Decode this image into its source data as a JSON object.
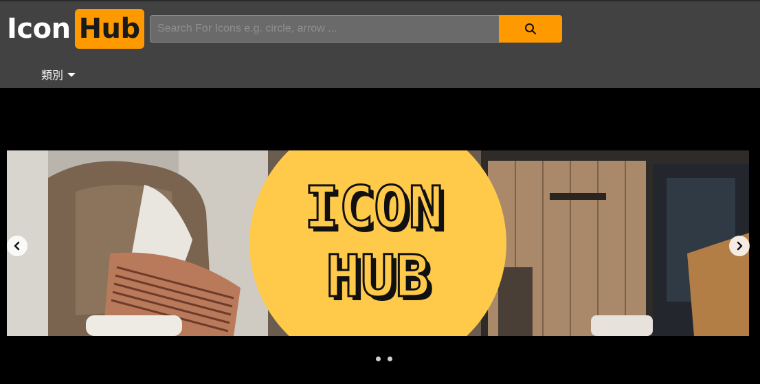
{
  "header": {
    "logo": {
      "part1": "Icon",
      "part2": "Hub"
    },
    "search": {
      "placeholder": "Search For Icons e.g. circle, arrow ...",
      "value": "",
      "button_icon": "search-icon"
    },
    "nav": {
      "categories_label": "類別",
      "categories_icon": "caret-down-icon"
    }
  },
  "carousel": {
    "banner_text": [
      "ICON",
      "HUB"
    ],
    "prev_icon": "chevron-left-icon",
    "next_icon": "chevron-right-icon",
    "slide_count": 2,
    "active_slide": 1
  },
  "colors": {
    "header_bg": "#424242",
    "accent": "#ff9900",
    "banner_circle": "#ffc94a",
    "page_bg": "#000000"
  }
}
